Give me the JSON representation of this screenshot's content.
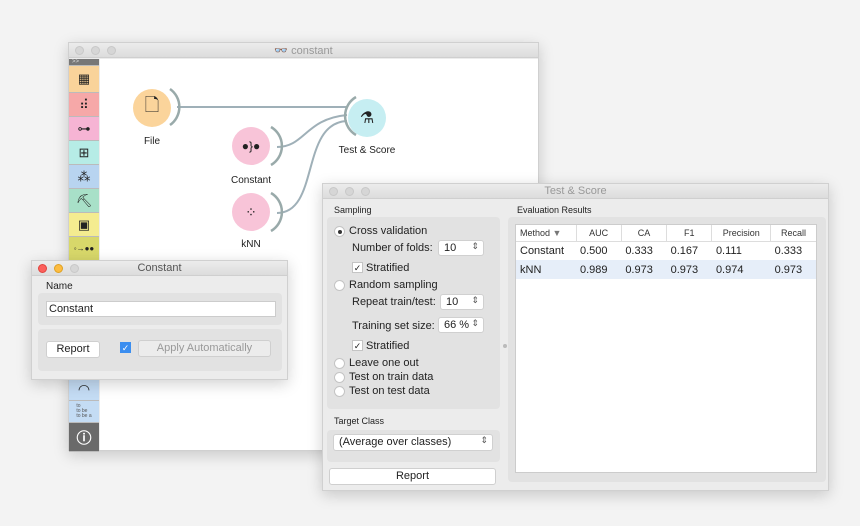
{
  "canvas_window": {
    "title": "constant",
    "sidebar_toggle": ">>",
    "sidebar": [
      {
        "icon": "table-icon",
        "color": "#f9d39a"
      },
      {
        "icon": "scatter-plot-icon",
        "color": "#f6a8a8"
      },
      {
        "icon": "tree-icon",
        "color": "#f6b4d4"
      },
      {
        "icon": "confusion-matrix-icon",
        "color": "#b6ece6"
      },
      {
        "icon": "clustering-icon",
        "color": "#b8d4f0"
      },
      {
        "icon": "worker-icon",
        "color": "#a8e0c8"
      },
      {
        "icon": "image-icon",
        "color": "#f4ec90"
      },
      {
        "icon": "flow-icon",
        "color": "#d8d86a"
      },
      {
        "icon": "arcs-icon",
        "color": "#c4dcf4"
      },
      {
        "icon": "text-icon",
        "color": "#c4dcf4",
        "text": "to\nto be\nto be a"
      },
      {
        "icon": "info-icon",
        "color": "#6a6a6a"
      }
    ],
    "nodes": [
      {
        "label": "File",
        "icon": "file-icon",
        "color": "#fbd49b"
      },
      {
        "label": "Test & Score",
        "icon": "flask-icon",
        "color": "#c6eef2"
      },
      {
        "label": "Constant",
        "icon": "constant-icon",
        "color": "#f8c4d8"
      },
      {
        "label": "kNN",
        "icon": "knn-icon",
        "color": "#f8c4d8"
      }
    ]
  },
  "constant_window": {
    "title": "Constant",
    "name_label": "Name",
    "name_value": "Constant",
    "report": "Report",
    "apply_auto": "Apply Automatically",
    "apply_checked": true
  },
  "test_score": {
    "title": "Test & Score",
    "sampling": "Sampling",
    "cross_validation": "Cross validation",
    "folds_label": "Number of folds:",
    "folds": "10",
    "stratified": "Stratified",
    "random_sampling": "Random sampling",
    "repeat_label": "Repeat train/test:",
    "repeat": "10",
    "train_size_label": "Training set size:",
    "train_size": "66 %",
    "stratified2": "Stratified",
    "leave_one_out": "Leave one out",
    "test_train": "Test on train data",
    "test_test": "Test on test data",
    "target_class": "Target Class",
    "target_value": "(Average over classes)",
    "report": "Report",
    "eval_results": "Evaluation Results",
    "columns": [
      "Method",
      "AUC",
      "CA",
      "F1",
      "Precision",
      "Recall"
    ],
    "rows": [
      [
        "Constant",
        "0.500",
        "0.333",
        "0.167",
        "0.111",
        "0.333"
      ],
      [
        "kNN",
        "0.989",
        "0.973",
        "0.973",
        "0.974",
        "0.973"
      ]
    ]
  }
}
